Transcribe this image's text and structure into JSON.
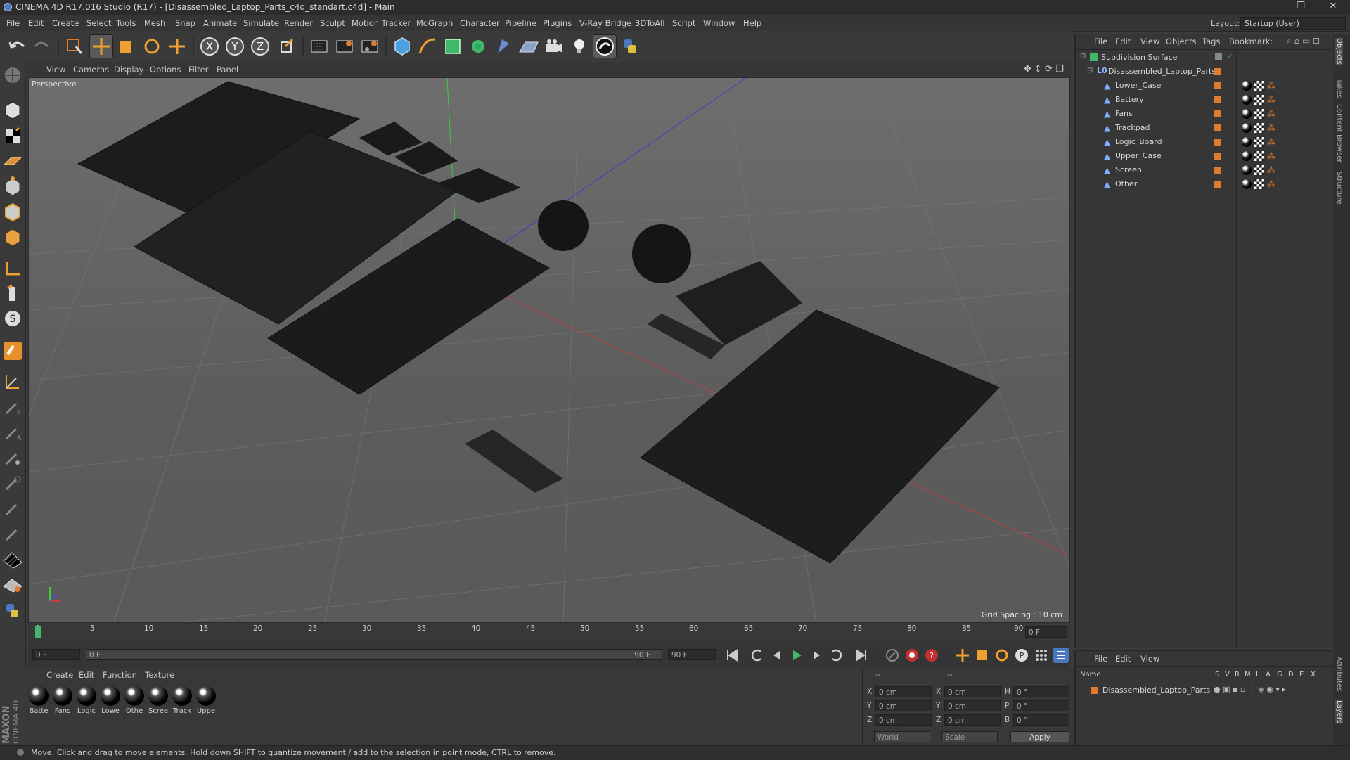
{
  "window": {
    "title": "CINEMA 4D R17.016 Studio (R17) - [Disassembled_Laptop_Parts_c4d_standart.c4d] - Main",
    "minimize": "–",
    "restore": "❐",
    "close": "✕"
  },
  "menubar": [
    "File",
    "Edit",
    "Create",
    "Select",
    "Tools",
    "Mesh",
    "Snap",
    "Animate",
    "Simulate",
    "Render",
    "Sculpt",
    "Motion Tracker",
    "MoGraph",
    "Character",
    "Pipeline",
    "Plugins",
    "V-Ray Bridge",
    "3DToAll",
    "Script",
    "Window",
    "Help"
  ],
  "layout": {
    "label": "Layout:",
    "value": "Startup (User)"
  },
  "toolbar": {
    "axis_x": "X",
    "axis_y": "Y",
    "axis_z": "Z"
  },
  "viewport": {
    "menu": [
      "View",
      "Cameras",
      "Display",
      "Options",
      "Filter",
      "Panel"
    ],
    "label": "Perspective",
    "grid_spacing": "Grid Spacing : 10 cm"
  },
  "timeline": {
    "ticks": [
      "0",
      "5",
      "10",
      "15",
      "20",
      "25",
      "30",
      "35",
      "40",
      "45",
      "50",
      "55",
      "60",
      "65",
      "70",
      "75",
      "80",
      "85",
      "90"
    ],
    "current_frame_right": "0 F",
    "start_field": "0 F",
    "slider_start": "0 F",
    "slider_end": "90 F",
    "end_field": "90 F"
  },
  "materials": {
    "menu": [
      "Create",
      "Edit",
      "Function",
      "Texture"
    ],
    "items": [
      "Batte",
      "Fans",
      "Logic",
      "Lowe",
      "Othe",
      "Scree",
      "Track",
      "Uppe"
    ]
  },
  "coords": {
    "header": "--",
    "header2": "--",
    "rows": [
      {
        "a": "X",
        "av": "0 cm",
        "b": "X",
        "bv": "0 cm",
        "c": "H",
        "cv": "0 °"
      },
      {
        "a": "Y",
        "av": "0 cm",
        "b": "Y",
        "bv": "0 cm",
        "c": "P",
        "cv": "0 °"
      },
      {
        "a": "Z",
        "av": "0 cm",
        "b": "Z",
        "bv": "0 cm",
        "c": "B",
        "cv": "0 °"
      }
    ],
    "world": "World",
    "scale": "Scale",
    "apply": "Apply"
  },
  "objects": {
    "menu": [
      "File",
      "Edit",
      "View",
      "Objects",
      "Tags",
      "Bookmark:"
    ],
    "tree": [
      {
        "name": "Subdivision Surface",
        "indent": 0
      },
      {
        "name": "Disassembled_Laptop_Parts",
        "indent": 1
      },
      {
        "name": "Lower_Case",
        "indent": 2
      },
      {
        "name": "Battery",
        "indent": 2
      },
      {
        "name": "Fans",
        "indent": 2
      },
      {
        "name": "Trackpad",
        "indent": 2
      },
      {
        "name": "Logic_Board",
        "indent": 2
      },
      {
        "name": "Upper_Case",
        "indent": 2
      },
      {
        "name": "Screen",
        "indent": 2
      },
      {
        "name": "Other",
        "indent": 2
      }
    ]
  },
  "attributes": {
    "menu": [
      "File",
      "Edit",
      "View"
    ],
    "columns": [
      "Name",
      "S",
      "V",
      "R",
      "M",
      "L",
      "A",
      "G",
      "D",
      "E",
      "X"
    ],
    "row": "Disassembled_Laptop_Parts"
  },
  "right_tabs": [
    "Objects",
    "Takes",
    "Content Browser",
    "Structure",
    "Attributes",
    "Layers"
  ],
  "status": "Move: Click and drag to move elements. Hold down SHIFT to quantize movement / add to the selection in point mode, CTRL to remove.",
  "maxon": {
    "line1": "MAXON",
    "line2": "CINEMA 4D"
  },
  "colors": {
    "accent_orange": "#e07a2c",
    "selection_blue": "#4a78c0",
    "bg": "#3b3b3b"
  }
}
